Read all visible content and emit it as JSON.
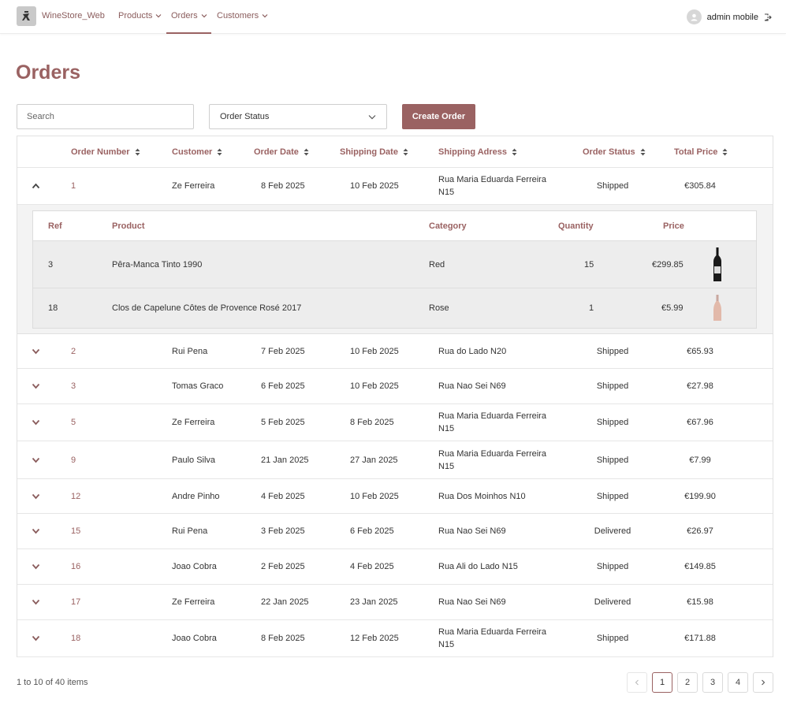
{
  "header": {
    "brand": "WineStore_Web",
    "nav": [
      {
        "label": "Products"
      },
      {
        "label": "Orders"
      },
      {
        "label": "Customers"
      }
    ],
    "user_name": "admin mobile"
  },
  "page": {
    "title": "Orders"
  },
  "controls": {
    "search_placeholder": "Search",
    "status_select": "Order Status",
    "create_label": "Create Order"
  },
  "table": {
    "columns": [
      "Order Number",
      "Customer",
      "Order Date",
      "Shipping Date",
      "Shipping Adress",
      "Order Status",
      "Total Price"
    ],
    "rows": [
      {
        "num": "1",
        "customer": "Ze Ferreira",
        "order_date": "8 Feb 2025",
        "ship_date": "10 Feb 2025",
        "address": "Rua Maria Eduarda Ferreira N15",
        "status": "Shipped",
        "total": "€305.84",
        "expanded": true
      },
      {
        "num": "2",
        "customer": "Rui  Pena",
        "order_date": "7 Feb 2025",
        "ship_date": "10 Feb 2025",
        "address": "Rua do Lado N20",
        "status": "Shipped",
        "total": "€65.93"
      },
      {
        "num": "3",
        "customer": "Tomas Graco",
        "order_date": "6 Feb 2025",
        "ship_date": "10 Feb 2025",
        "address": "Rua Nao Sei N69",
        "status": "Shipped",
        "total": "€27.98"
      },
      {
        "num": "5",
        "customer": "Ze Ferreira",
        "order_date": "5 Feb 2025",
        "ship_date": "8 Feb 2025",
        "address": "Rua Maria Eduarda Ferreira N15",
        "status": "Shipped",
        "total": "€67.96"
      },
      {
        "num": "9",
        "customer": "Paulo Silva",
        "order_date": "21 Jan 2025",
        "ship_date": "27 Jan 2025",
        "address": "Rua Maria Eduarda Ferreira N15",
        "status": "Shipped",
        "total": "€7.99"
      },
      {
        "num": "12",
        "customer": "Andre Pinho",
        "order_date": "4 Feb 2025",
        "ship_date": "10 Feb 2025",
        "address": "Rua Dos Moinhos N10",
        "status": "Shipped",
        "total": "€199.90"
      },
      {
        "num": "15",
        "customer": "Rui  Pena",
        "order_date": "3 Feb 2025",
        "ship_date": "6 Feb 2025",
        "address": "Rua Nao Sei N69",
        "status": "Delivered",
        "total": "€26.97"
      },
      {
        "num": "16",
        "customer": "Joao Cobra",
        "order_date": "2 Feb 2025",
        "ship_date": "4 Feb 2025",
        "address": "Rua Ali do Lado N15",
        "status": "Shipped",
        "total": "€149.85"
      },
      {
        "num": "17",
        "customer": "Ze Ferreira",
        "order_date": "22 Jan 2025",
        "ship_date": "23 Jan 2025",
        "address": "Rua Nao Sei N69",
        "status": "Delivered",
        "total": "€15.98"
      },
      {
        "num": "18",
        "customer": "Joao Cobra",
        "order_date": "8 Feb 2025",
        "ship_date": "12 Feb 2025",
        "address": "Rua Maria Eduarda Ferreira N15",
        "status": "Shipped",
        "total": "€171.88"
      }
    ]
  },
  "detail": {
    "columns": [
      "Ref",
      "Product",
      "Category",
      "Quantity",
      "Price"
    ],
    "rows": [
      {
        "ref": "3",
        "product": "Pêra-Manca Tinto 1990",
        "category": "Red",
        "quantity": "15",
        "price": "€299.85",
        "bottle": "red-wine-bottle-icon"
      },
      {
        "ref": "18",
        "product": "Clos de Capelune Côtes de Provence Rosé 2017",
        "category": "Rose",
        "quantity": "1",
        "price": "€5.99",
        "bottle": "rose-wine-bottle-icon"
      }
    ]
  },
  "footer": {
    "items_summary": "1 to 10 of 40 items",
    "pages": [
      "1",
      "2",
      "3",
      "4"
    ],
    "current_page": "1"
  },
  "colors": {
    "accent": "#9a6262"
  }
}
